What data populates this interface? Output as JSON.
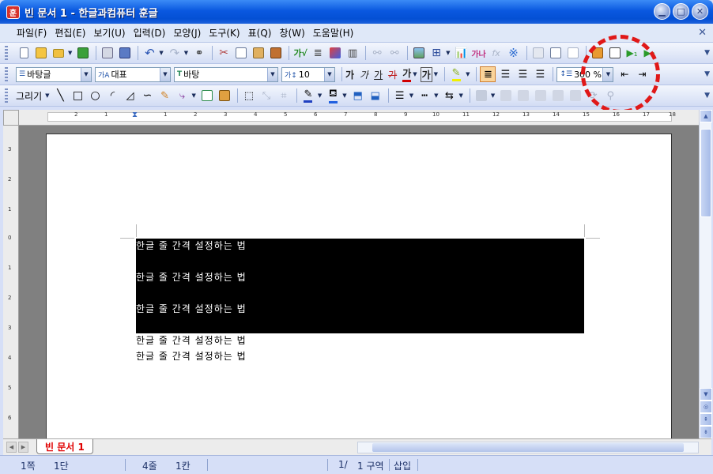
{
  "window": {
    "title": "빈 문서 1 - 한글과컴퓨터 훈글",
    "app_icon": "훈"
  },
  "menu": [
    "파일(F)",
    "편집(E)",
    "보기(U)",
    "입력(D)",
    "모양(J)",
    "도구(K)",
    "표(Q)",
    "창(W)",
    "도움말(H)"
  ],
  "format_bar": {
    "style": "바탕글",
    "font_lang": "대표",
    "font_name": "바탕",
    "font_size": "10",
    "zoom": "300 %",
    "char_buttons": [
      "가",
      "가",
      "가",
      "가",
      "가",
      "가"
    ]
  },
  "draw_bar": {
    "label": "그리기"
  },
  "ruler": {
    "h_numbers": [
      "2",
      "1",
      "1",
      "2",
      "3",
      "4",
      "5",
      "6",
      "7",
      "8",
      "9",
      "10",
      "11",
      "12",
      "13",
      "14",
      "15",
      "16",
      "17",
      "18"
    ],
    "v_numbers": [
      "3",
      "2",
      "1",
      "0",
      "1",
      "2",
      "3",
      "4",
      "5",
      "6"
    ]
  },
  "document": {
    "lines": [
      "한글 줄 간격 설정하는 법",
      "한글 줄 간격 설정하는 법",
      "한글 줄 간격 설정하는 법",
      "한글 줄 간격 설정하는 법",
      "한글 줄 간격 설정하는 법"
    ]
  },
  "tabs": {
    "doc_tab": "빈 문서 1"
  },
  "status": {
    "page": "1쪽",
    "column": "1단",
    "line": "4줄",
    "col": "1칸",
    "section_num": "1/",
    "section": "1 구역",
    "mode": "삽입"
  },
  "colors": {
    "title_bar": "#0a58e0",
    "annotation": "#e01818",
    "selection": "#000000",
    "doc_tab": "#e00000"
  }
}
